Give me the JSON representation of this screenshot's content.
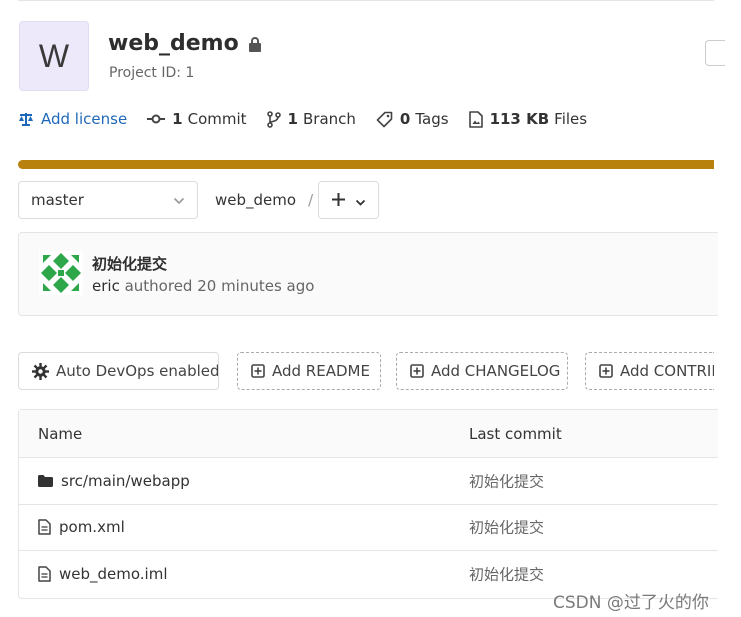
{
  "project": {
    "avatar_letter": "W",
    "name": "web_demo",
    "id_text": "Project ID: 1"
  },
  "stats": {
    "license": "Add license",
    "commits_count": "1",
    "commits_label": "Commit",
    "branches_count": "1",
    "branches_label": "Branch",
    "tags_count": "0",
    "tags_label": "Tags",
    "files_size": "113 KB",
    "files_label": "Files"
  },
  "colors": {
    "language_bar": "#b8800d",
    "link": "#1f68b9"
  },
  "branch": {
    "selected": "master",
    "path": "web_demo",
    "separator": "/"
  },
  "commit": {
    "message": "初始化提交",
    "author": "eric",
    "meta": "authored 20 minutes ago"
  },
  "actions": [
    {
      "label": "Auto DevOps enabled",
      "icon": "gear-icon"
    },
    {
      "label": "Add README",
      "icon": "plus-square-icon"
    },
    {
      "label": "Add CHANGELOG",
      "icon": "plus-square-icon"
    },
    {
      "label": "Add CONTRIBUTING",
      "icon": "plus-square-icon"
    }
  ],
  "table": {
    "headers": {
      "name": "Name",
      "last_commit": "Last commit"
    },
    "rows": [
      {
        "name": "src/main/webapp",
        "type": "folder-icon",
        "last_commit": "初始化提交"
      },
      {
        "name": "pom.xml",
        "type": "file-icon",
        "last_commit": "初始化提交"
      },
      {
        "name": "web_demo.iml",
        "type": "file-icon",
        "last_commit": "初始化提交"
      }
    ]
  },
  "watermark": "CSDN @过了火的你"
}
